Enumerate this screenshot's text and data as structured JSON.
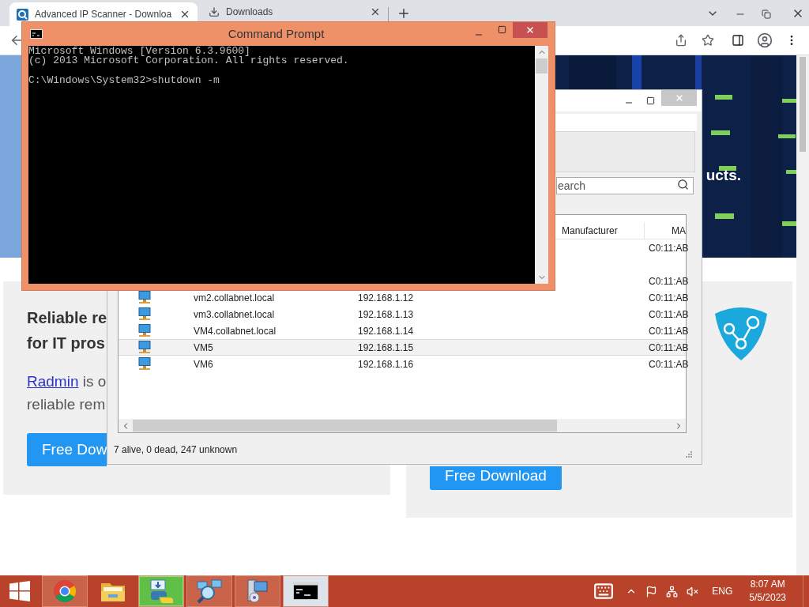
{
  "browser": {
    "tabs": [
      {
        "title": "Advanced IP Scanner - Downloa",
        "selected": true,
        "kind": "site"
      },
      {
        "title": "Downloads",
        "selected": false,
        "kind": "downloads"
      }
    ],
    "page": {
      "hero_text": "ucts.",
      "left_card": {
        "heading": [
          "Reliable re",
          "for IT pros"
        ],
        "link": "Radmin",
        "lines": [
          "is o",
          "reliable rem"
        ],
        "button": "Free Dow"
      },
      "right_card": {
        "button": "Free Download"
      }
    }
  },
  "scanner": {
    "search": {
      "placeholder": "earch"
    },
    "columns": [
      "Manufacturer",
      "MA"
    ],
    "rows": [
      {
        "mac": "C0:11:AB",
        "selected": false
      },
      {
        "selected": false
      },
      {
        "mac": "C0:11:AB",
        "selected": false
      },
      {
        "name": "vm2.collabnet.local",
        "ip": "192.168.1.12",
        "mac": "C0:11:AB",
        "selected": false
      },
      {
        "name": "vm3.collabnet.local",
        "ip": "192.168.1.13",
        "mac": "C0:11:AB",
        "selected": false
      },
      {
        "name": "VM4.collabnet.local",
        "ip": "192.168.1.14",
        "mac": "C0:11:AB",
        "selected": false
      },
      {
        "name": "VM5",
        "ip": "192.168.1.15",
        "mac": "C0:11:AB",
        "selected": true
      },
      {
        "name": "VM6",
        "ip": "192.168.1.16",
        "mac": "C0:11:AB",
        "selected": false
      }
    ],
    "status": "7 alive, 0 dead, 247 unknown"
  },
  "console": {
    "title": "Command Prompt",
    "output": [
      "Microsoft Windows [Version 6.3.9600]",
      "(c) 2013 Microsoft Corporation. All rights reserved."
    ],
    "prompt": "C:\\Windows\\System32>shutdown -m"
  },
  "taskbar": {
    "items": [
      {
        "kind": "browser",
        "selected": false,
        "running": true,
        "highlighted": false
      },
      {
        "kind": "folder",
        "selected": false,
        "running": false,
        "highlighted": false
      },
      {
        "kind": "installer",
        "selected": false,
        "running": true,
        "highlighted": true
      },
      {
        "kind": "scanner",
        "selected": false,
        "running": true,
        "highlighted": false
      },
      {
        "kind": "setup",
        "selected": false,
        "running": true,
        "highlighted": false
      },
      {
        "kind": "console",
        "selected": true,
        "running": true,
        "highlighted": false
      }
    ],
    "language": "ENG",
    "time": "8:07 AM",
    "date": "5/5/2023"
  }
}
